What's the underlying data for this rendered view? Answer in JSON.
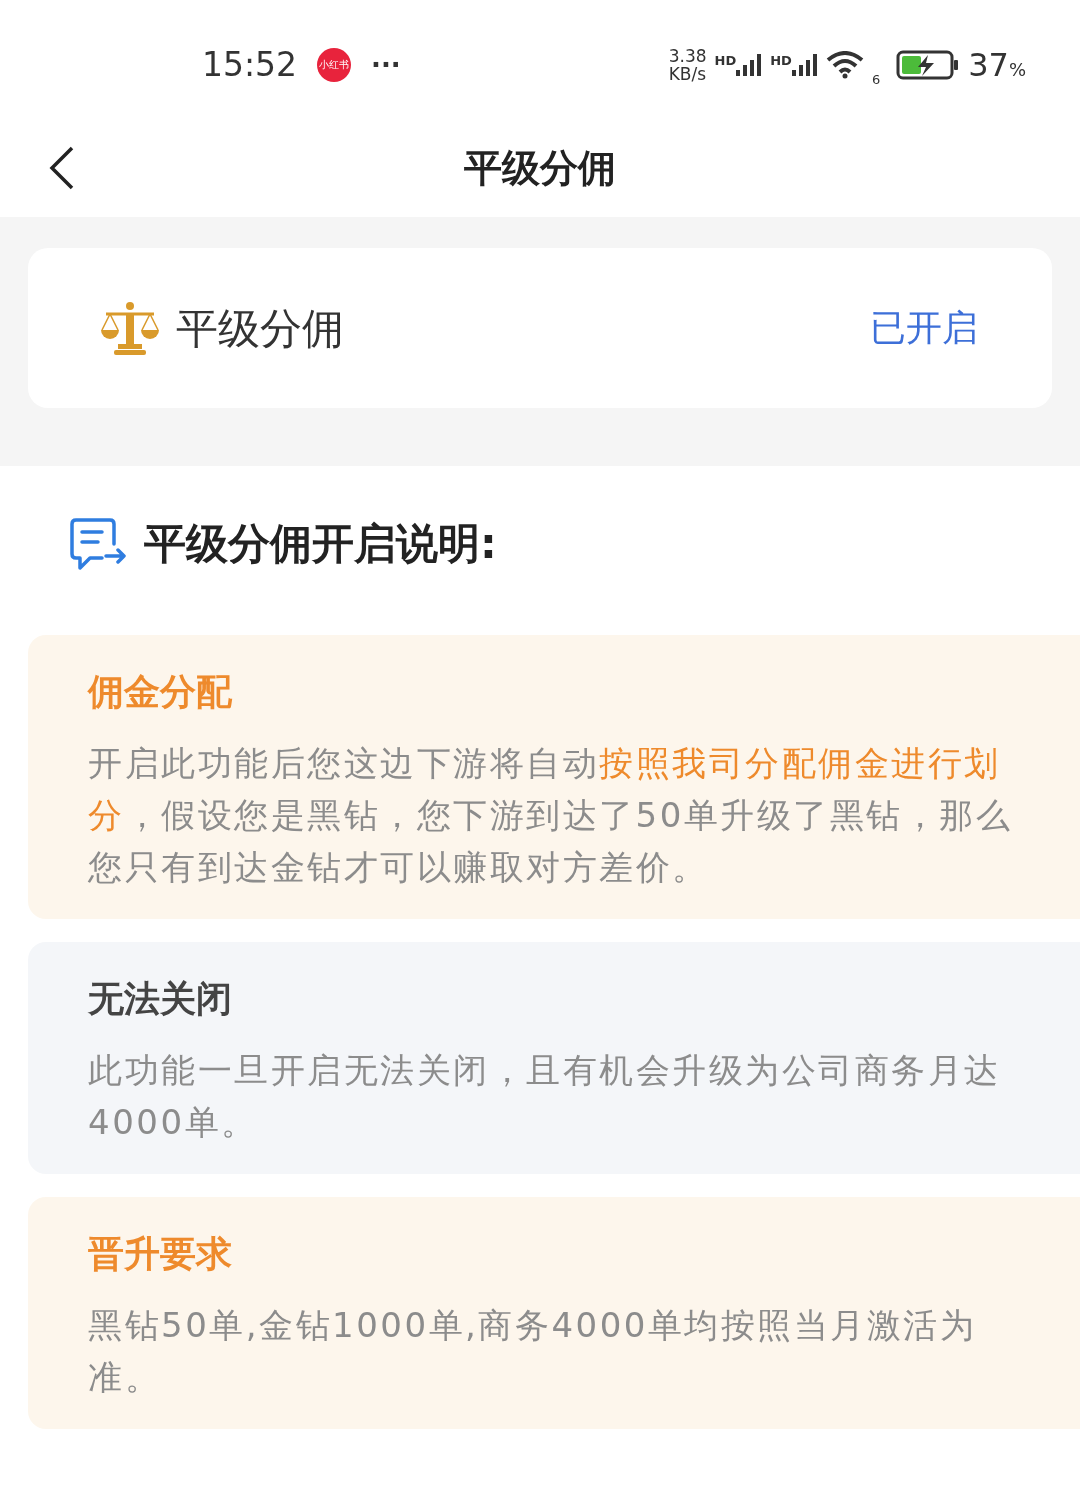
{
  "status_bar": {
    "time": "15:52",
    "app_badge": "小红书",
    "more": "···",
    "net_speed": "3.38",
    "net_unit": "KB/s",
    "signals": [
      "HD",
      "HD"
    ],
    "wifi_badge": "6",
    "battery": "37",
    "battery_unit": "%",
    "charging": true
  },
  "nav": {
    "title": "平级分佣"
  },
  "feature": {
    "label": "平级分佣",
    "status": "已开启",
    "on": true
  },
  "section_title": "平级分佣开启说明:",
  "cards": [
    {
      "kind": "warm",
      "title": "佣金分配",
      "body": [
        {
          "text": "开启此功能后您这边下游将自动",
          "highlight": false
        },
        {
          "text": "按照我司分配佣金进行划分",
          "highlight": true
        },
        {
          "text": "，假设您是黑钻，您下游到达了50单升级了黑钻，那么您只有到达金钻才可以赚取对方差价。",
          "highlight": false
        }
      ]
    },
    {
      "kind": "cool",
      "title": "无法关闭",
      "body": [
        {
          "text": "此功能一旦开启无法关闭，且有机会升级为公司商务月达4000单。",
          "highlight": false
        }
      ]
    },
    {
      "kind": "warm",
      "title": "晋升要求",
      "body": [
        {
          "text": "黑钻50单,金钻1000单,商务4000单均按照当月激活为准。",
          "highlight": false
        }
      ]
    }
  ]
}
